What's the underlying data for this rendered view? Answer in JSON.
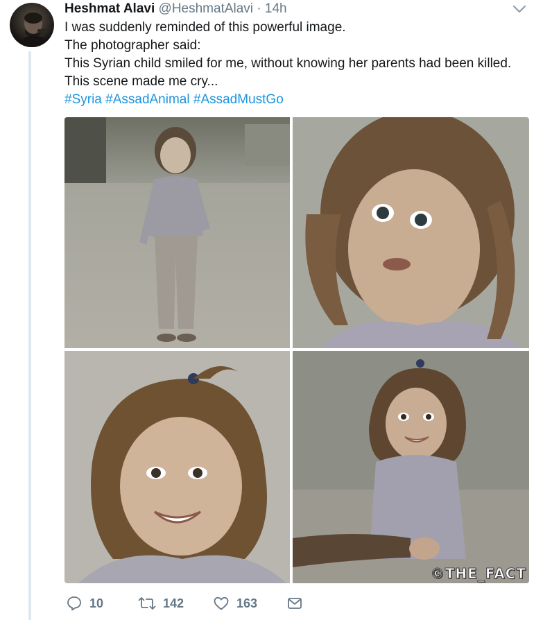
{
  "tweet": {
    "author_name": "Heshmat Alavi",
    "author_handle": "@HeshmatAlavi",
    "separator": "·",
    "timestamp": "14h",
    "lines": [
      "I was suddenly reminded of this powerful image.",
      "The photographer said:",
      "This Syrian child smiled for me, without knowing her parents had been killed.",
      "This scene made me cry..."
    ],
    "hashtags": [
      "#Syria",
      "#AssadAnimal",
      "#AssadMustGo"
    ],
    "media": {
      "watermark": "©THE_FACT"
    },
    "actions": {
      "reply_count": "10",
      "retweet_count": "142",
      "like_count": "163"
    }
  },
  "colors": {
    "link": "#1b95e0",
    "secondary_text": "#657786",
    "thread_line": "#dfe8ee"
  },
  "icons": {
    "reply": "reply-icon",
    "retweet": "retweet-icon",
    "like": "heart-icon",
    "message": "envelope-icon",
    "menu": "chevron-down-icon"
  }
}
